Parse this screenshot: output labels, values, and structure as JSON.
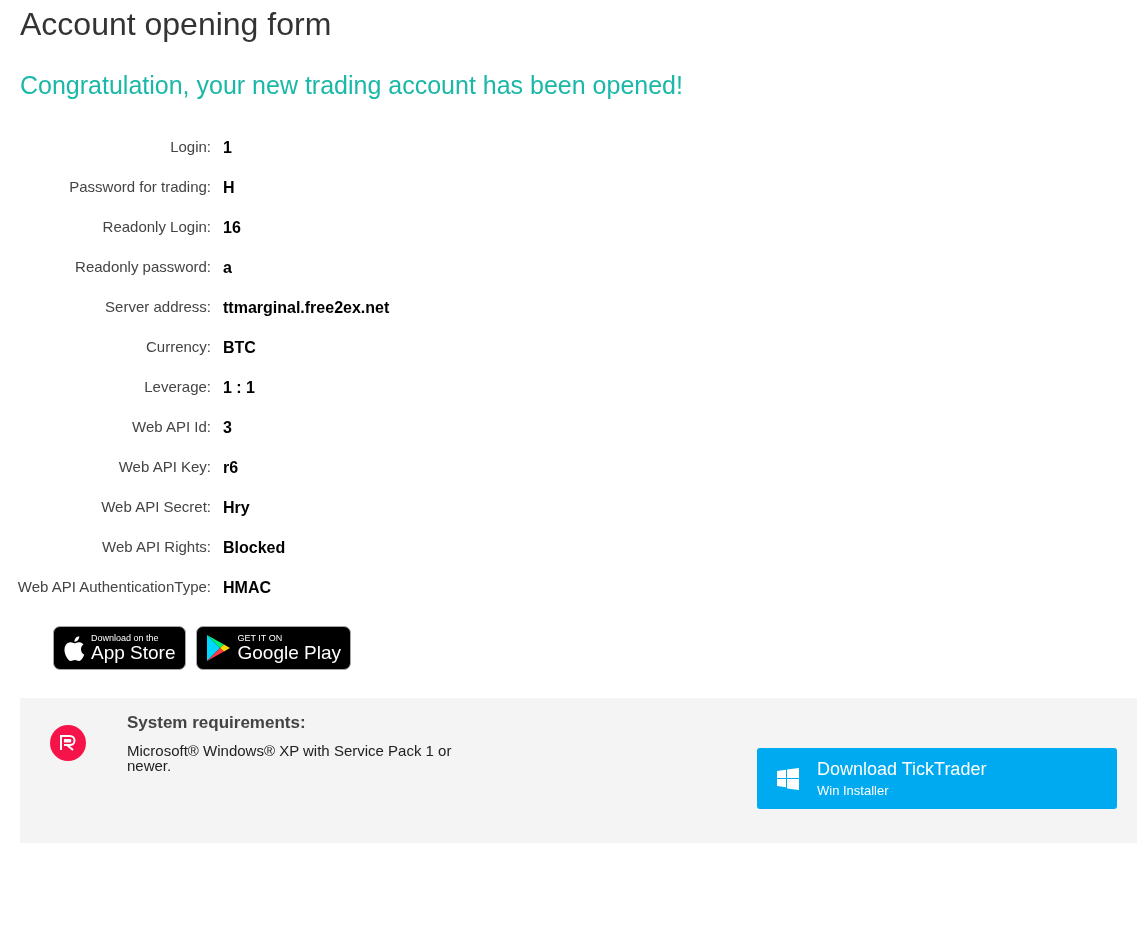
{
  "page_title": "Account opening form",
  "success_message": "Congratulation, your new trading account has been opened!",
  "fields": [
    {
      "label": "Login:",
      "value": "1"
    },
    {
      "label": "Password for trading:",
      "value": "H"
    },
    {
      "label": "Readonly Login:",
      "value": "16"
    },
    {
      "label": "Readonly password:",
      "value": "a"
    },
    {
      "label": "Server address:",
      "value": "ttmarginal.free2ex.net"
    },
    {
      "label": "Currency:",
      "value": "BTC"
    },
    {
      "label": "Leverage:",
      "value": "1 : 1"
    },
    {
      "label": "Web API Id:",
      "value": "3"
    },
    {
      "label": "Web API Key:",
      "value": "r6"
    },
    {
      "label": "Web API Secret:",
      "value": "Hry"
    },
    {
      "label": "Web API Rights:",
      "value": "Blocked"
    },
    {
      "label": "Web API AuthenticationType:",
      "value": "HMAC"
    }
  ],
  "store_badges": [
    {
      "kind": "apple",
      "small": "Download on the",
      "big": "App Store"
    },
    {
      "kind": "google",
      "small": "GET IT ON",
      "big": "Google Play"
    }
  ],
  "download_panel": {
    "heading": "System requirements:",
    "requirements": "Microsoft® Windows® XP with Service Pack 1 or newer.",
    "button": {
      "title": "Download TickTrader",
      "subtitle": "Win Installer"
    }
  }
}
